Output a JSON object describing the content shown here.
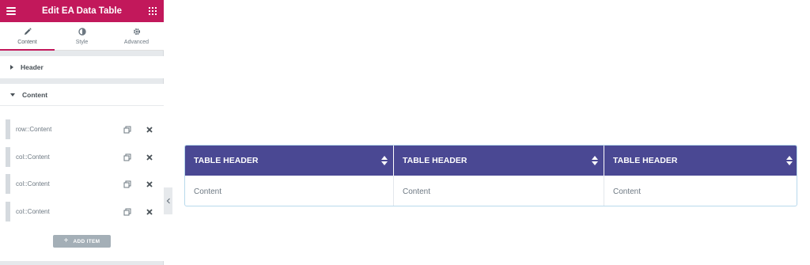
{
  "panel": {
    "title": "Edit EA Data Table",
    "tabs": [
      {
        "label": "Content",
        "icon": "pencil-icon",
        "active": true
      },
      {
        "label": "Style",
        "icon": "half-circle-icon",
        "active": false
      },
      {
        "label": "Advanced",
        "icon": "gear-icon",
        "active": false
      }
    ],
    "sections": {
      "header": {
        "label": "Header",
        "expanded": false
      },
      "content": {
        "label": "Content",
        "expanded": true
      }
    },
    "repeater_items": [
      {
        "label": "row::Content"
      },
      {
        "label": "col::Content"
      },
      {
        "label": "col::Content"
      },
      {
        "label": "col::Content"
      }
    ],
    "add_item_label": "ADD ITEM"
  },
  "table": {
    "headers": [
      "TABLE HEADER",
      "TABLE HEADER",
      "TABLE HEADER"
    ],
    "rows": [
      [
        "Content",
        "Content",
        "Content"
      ]
    ]
  },
  "colors": {
    "accent": "#c2185b",
    "table_header_bg": "#4a4893",
    "table_border": "#b8d9ec",
    "panel_bg": "#e6e9ec"
  }
}
